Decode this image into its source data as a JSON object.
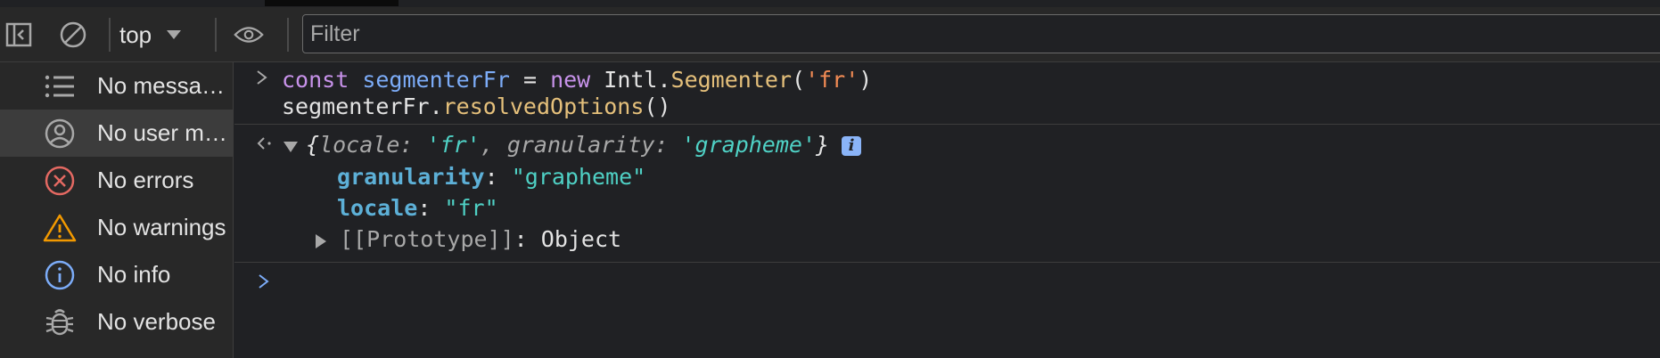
{
  "toolbar": {
    "context_label": "top",
    "filter_placeholder": "Filter"
  },
  "sidebar": {
    "items": [
      {
        "label": "No messa…",
        "icon": "list-icon",
        "active": false
      },
      {
        "label": "No user m…",
        "icon": "user-icon",
        "active": true
      },
      {
        "label": "No errors",
        "icon": "error-icon",
        "active": false
      },
      {
        "label": "No warnings",
        "icon": "warning-icon",
        "active": false
      },
      {
        "label": "No info",
        "icon": "info-icon",
        "active": false
      },
      {
        "label": "No verbose",
        "icon": "bug-icon",
        "active": false
      }
    ]
  },
  "console": {
    "input": {
      "l1": {
        "kw": "const",
        "var": "segmenterFr",
        "eq": " = ",
        "new": "new",
        "obj": " Intl.",
        "cls": "Segmenter",
        "p1": "(",
        "str": "'fr'",
        "p2": ")"
      },
      "l2": {
        "var": "segmenterFr.",
        "method": "resolvedOptions",
        "parens": "()"
      }
    },
    "output": {
      "open": "{",
      "k1": "locale",
      "colon1": ": ",
      "v1": "'fr'",
      "comma": ", ",
      "k2": "granularity",
      "colon2": ": ",
      "v2": "'grapheme'",
      "close": "}",
      "info": "i",
      "props": [
        {
          "key": "granularity",
          "value": "\"grapheme\""
        },
        {
          "key": "locale",
          "value": "\"fr\""
        }
      ],
      "proto_key": "[[Prototype]]",
      "proto_value": "Object"
    }
  },
  "colors": {
    "background": "#202124",
    "panel": "#282828",
    "keyword": "#c792ea",
    "string": "#f28b54",
    "function": "#e5c07b",
    "property": "#5db0d7",
    "output_string": "#4fd1c5"
  }
}
